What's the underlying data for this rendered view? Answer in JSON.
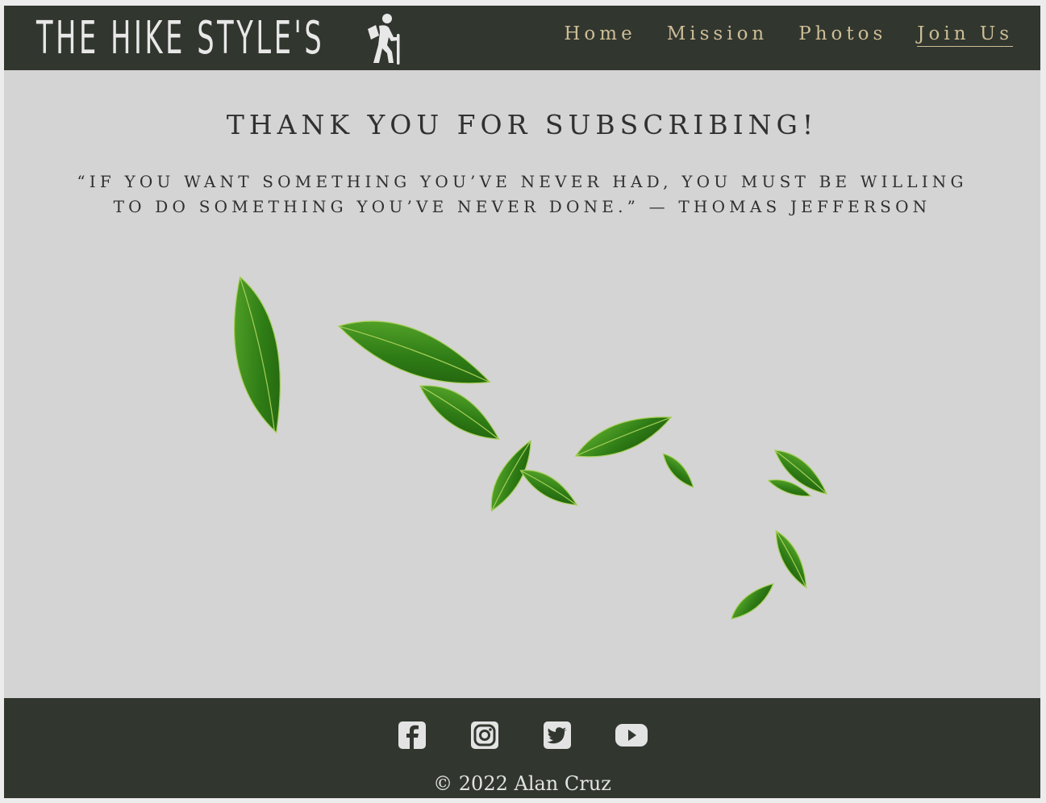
{
  "brand": {
    "title": "THE HIKE STYLE'S",
    "logo_icon": "hiker-icon"
  },
  "nav": {
    "items": [
      {
        "label": "Home",
        "active": false
      },
      {
        "label": "Mission",
        "active": false
      },
      {
        "label": "Photos",
        "active": false
      },
      {
        "label": "Join Us",
        "active": true
      }
    ]
  },
  "main": {
    "title": "THANK YOU FOR SUBSCRIBING!",
    "quote_line1": "“IF YOU WANT SOMETHING YOU’VE NEVER HAD, YOU MUST BE WILLING",
    "quote_line2": "TO DO SOMETHING YOU’VE NEVER DONE.” — THOMAS JEFFERSON",
    "image": "falling-green-leaves"
  },
  "footer": {
    "social": [
      "facebook-icon",
      "instagram-icon",
      "twitter-icon",
      "youtube-icon"
    ],
    "copyright": "© 2022 Alan Cruz"
  },
  "colors": {
    "header_bg": "#31362f",
    "nav_text": "#cdbd96",
    "page_bg": "#d4d4d4",
    "text": "#2f302f",
    "leaf": "#3f8a1f"
  }
}
